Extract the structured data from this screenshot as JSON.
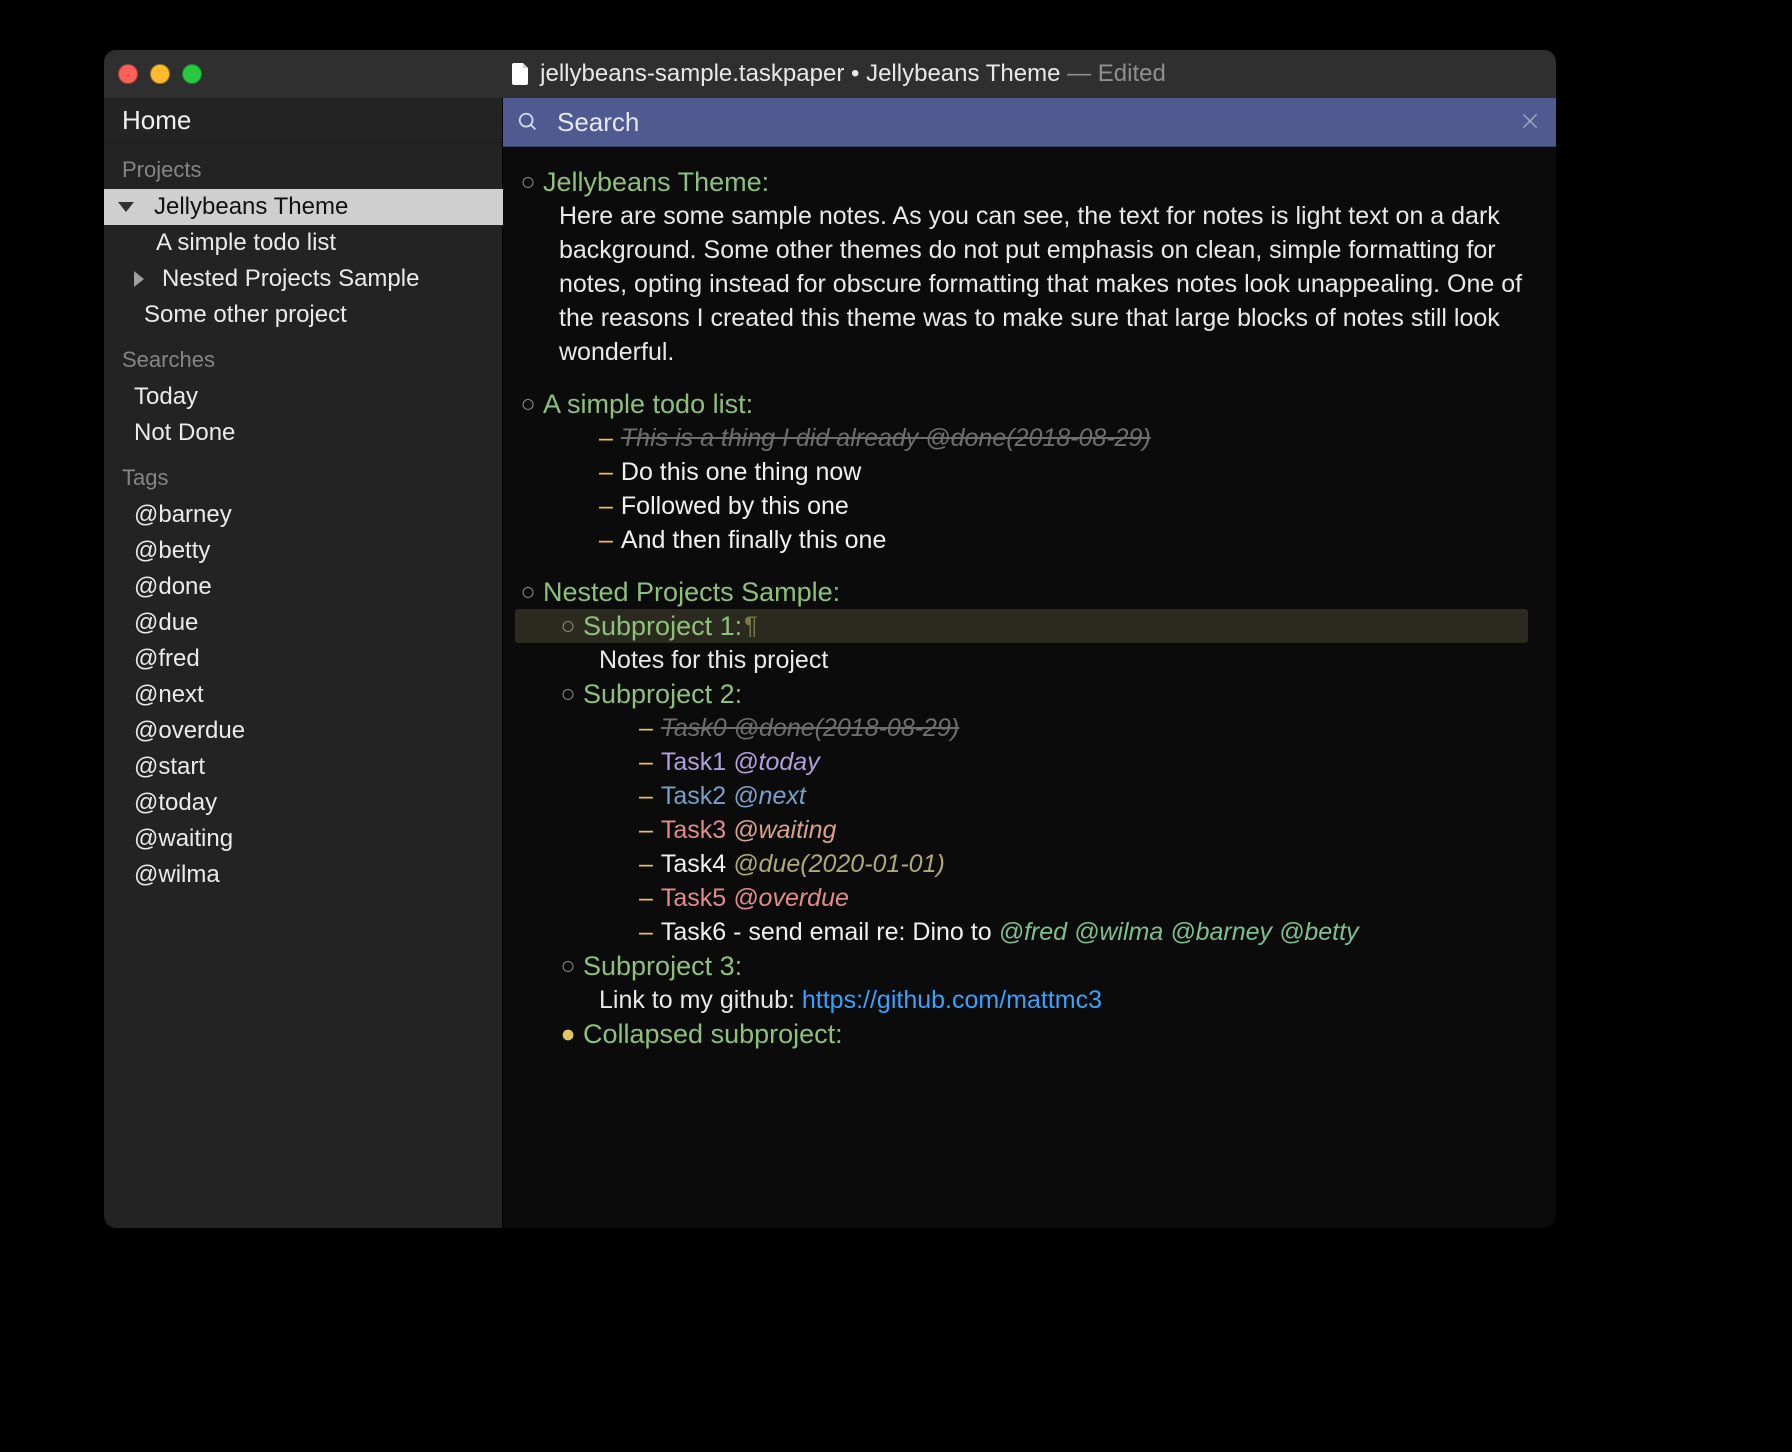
{
  "title": {
    "filename": "jellybeans-sample.taskpaper",
    "sep": " • ",
    "theme": "Jellybeans Theme",
    "dash": "—",
    "status": "Edited"
  },
  "search": {
    "placeholder": "Search"
  },
  "sidebar": {
    "home": "Home",
    "projects": {
      "header": "Projects",
      "items": [
        {
          "label": "Jellybeans Theme",
          "selected": true,
          "expanded": true
        },
        {
          "label": "A simple todo list"
        },
        {
          "label": "Nested Projects Sample",
          "expanded": false
        },
        {
          "label": "Some other project"
        }
      ]
    },
    "searches": {
      "header": "Searches",
      "items": [
        "Today",
        "Not Done"
      ]
    },
    "tags": {
      "header": "Tags",
      "items": [
        "@barney",
        "@betty",
        "@done",
        "@due",
        "@fred",
        "@next",
        "@overdue",
        "@start",
        "@today",
        "@waiting",
        "@wilma"
      ]
    }
  },
  "doc": {
    "jelly": {
      "heading": "Jellybeans Theme:",
      "note": "Here are some sample notes. As you can see, the text for notes is light text on a dark background. Some other themes do not put emphasis on clean, simple formatting for notes, opting instead for obscure formatting that makes notes look unappealing. One of the reasons I created this theme was to make sure that large blocks of notes still look wonderful."
    },
    "todo": {
      "heading": "A simple todo list:",
      "items": [
        {
          "text": "This is a thing I did already",
          "tag": "@done(2018-08-29)"
        },
        {
          "text": "Do this one thing now"
        },
        {
          "text": "Followed by this one"
        },
        {
          "text": "And then finally this one"
        }
      ]
    },
    "nested": {
      "heading": "Nested Projects Sample:",
      "sub1": {
        "heading": "Subproject 1:",
        "note": "Notes for this project"
      },
      "sub2": {
        "heading": "Subproject 2:",
        "items": [
          {
            "text": "Task0",
            "tag": "@done(2018-08-29)"
          },
          {
            "text": "Task1",
            "tag": "@today"
          },
          {
            "text": "Task2",
            "tag": "@next"
          },
          {
            "text": "Task3",
            "tag": "@waiting"
          },
          {
            "text": "Task4",
            "tag": "@due(2020-01-01)"
          },
          {
            "text": "Task5",
            "tag": "@overdue"
          },
          {
            "text": "Task6 - send email re: Dino to",
            "tags": [
              "@fred",
              "@wilma",
              "@barney",
              "@betty"
            ]
          }
        ]
      },
      "sub3": {
        "heading": "Subproject 3:",
        "note_prefix": "Link to my github:",
        "link": "https://github.com/mattmc3"
      },
      "collapsed": {
        "heading": "Collapsed subproject:"
      }
    }
  }
}
